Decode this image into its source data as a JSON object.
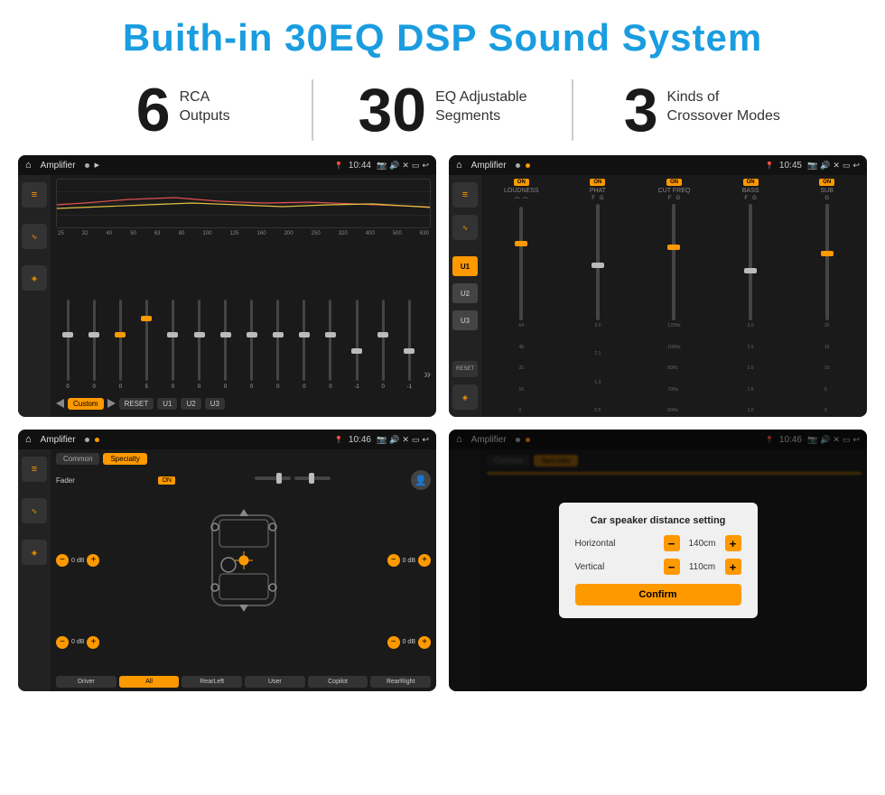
{
  "header": {
    "title": "Buith-in 30EQ DSP Sound System"
  },
  "stats": [
    {
      "number": "6",
      "line1": "RCA",
      "line2": "Outputs"
    },
    {
      "number": "30",
      "line1": "EQ Adjustable",
      "line2": "Segments"
    },
    {
      "number": "3",
      "line1": "Kinds of",
      "line2": "Crossover Modes"
    }
  ],
  "screens": [
    {
      "id": "screen1",
      "statusBar": {
        "appName": "Amplifier",
        "time": "10:44"
      },
      "type": "eq"
    },
    {
      "id": "screen2",
      "statusBar": {
        "appName": "Amplifier",
        "time": "10:45"
      },
      "type": "crossover"
    },
    {
      "id": "screen3",
      "statusBar": {
        "appName": "Amplifier",
        "time": "10:46"
      },
      "type": "fader"
    },
    {
      "id": "screen4",
      "statusBar": {
        "appName": "Amplifier",
        "time": "10:46"
      },
      "type": "dialog"
    }
  ],
  "eq": {
    "freqLabels": [
      "25",
      "32",
      "40",
      "50",
      "63",
      "80",
      "100",
      "125",
      "160",
      "200",
      "250",
      "320",
      "400",
      "500",
      "630"
    ],
    "values": [
      "0",
      "0",
      "0",
      "5",
      "0",
      "0",
      "0",
      "0",
      "0",
      "0",
      "0",
      "-1",
      "0",
      "-1"
    ],
    "buttons": [
      "Custom",
      "RESET",
      "U1",
      "U2",
      "U3"
    ]
  },
  "crossover": {
    "uButtons": [
      "U1",
      "U2",
      "U3"
    ],
    "channels": [
      {
        "label": "LOUDNESS",
        "on": true,
        "sliderPos": 0.3
      },
      {
        "label": "PHAT",
        "on": true,
        "sliderPos": 0.5
      },
      {
        "label": "CUT FREQ",
        "on": true,
        "sliderPos": 0.5
      },
      {
        "label": "BASS",
        "on": true,
        "sliderPos": 0.6
      },
      {
        "label": "SUB",
        "on": true,
        "sliderPos": 0.4
      }
    ]
  },
  "fader": {
    "tabs": [
      "Common",
      "Specialty"
    ],
    "activeTab": "Specialty",
    "faderLabel": "Fader",
    "faderOn": true,
    "positions": {
      "frontLeft": "0 dB",
      "frontRight": "0 dB",
      "rearLeft": "0 dB",
      "rearRight": "0 dB"
    },
    "buttons": [
      "Driver",
      "All",
      "RearLeft",
      "User",
      "Copilot",
      "RearRight"
    ]
  },
  "dialog": {
    "title": "Car speaker distance setting",
    "horizontal": {
      "label": "Horizontal",
      "value": "140cm"
    },
    "vertical": {
      "label": "Vertical",
      "value": "110cm"
    },
    "confirmLabel": "Confirm"
  }
}
